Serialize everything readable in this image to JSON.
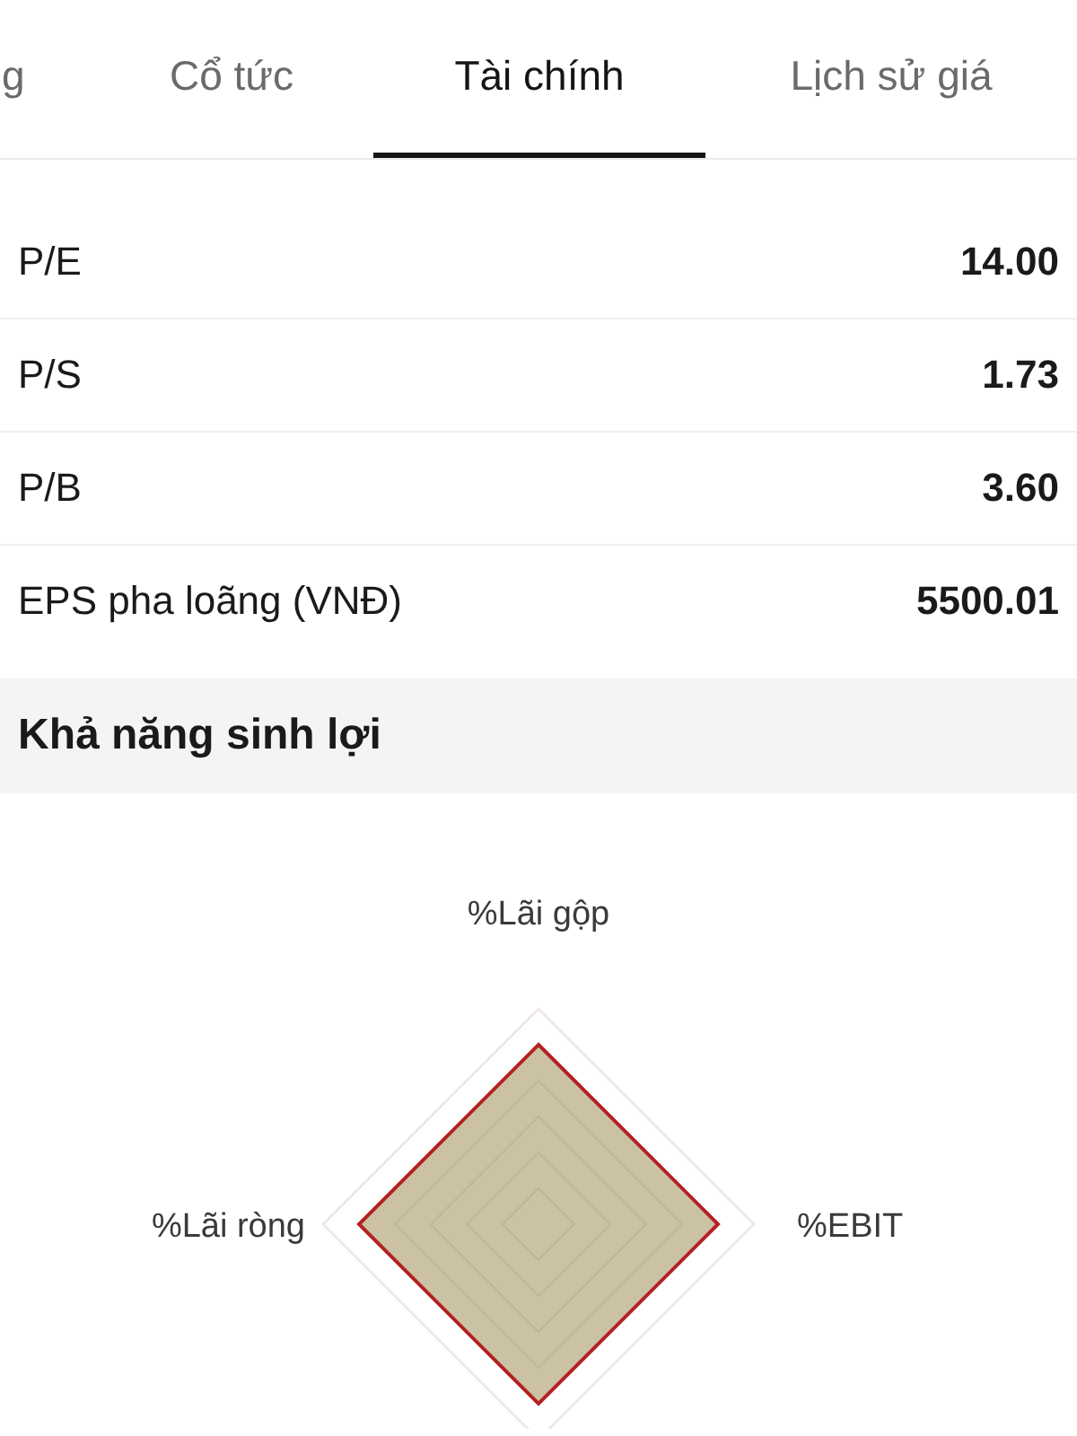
{
  "tabs": [
    {
      "label": "g",
      "selected": false
    },
    {
      "label": "Cổ tức",
      "selected": false
    },
    {
      "label": "Tài chính",
      "selected": true
    },
    {
      "label": "Lịch sử giá",
      "selected": false
    }
  ],
  "metrics": [
    {
      "label": "P/E",
      "value": "14.00"
    },
    {
      "label": "P/S",
      "value": "1.73"
    },
    {
      "label": "P/B",
      "value": "3.60"
    },
    {
      "label": "EPS pha loãng (VNĐ)",
      "value": "5500.01"
    }
  ],
  "profitability": {
    "title": "Khả năng sinh lợi",
    "axes": [
      "%Lãi gộp",
      "%EBIT",
      "%Lãi ròng"
    ]
  }
}
